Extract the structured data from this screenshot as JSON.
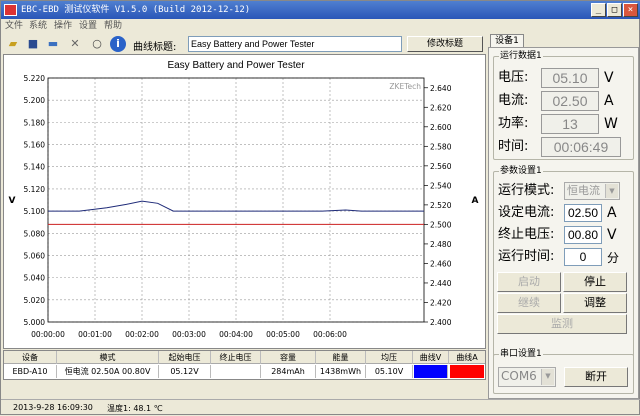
{
  "window": {
    "title": "EBC-EBD 测试仪软件 V1.5.0 (Build 2012-12-12)",
    "min": "_",
    "max": "□",
    "close": "×"
  },
  "menu": [
    "文件",
    "系统",
    "操作",
    "设置",
    "帮助"
  ],
  "toolbar": {
    "title_label": "曲线标题:",
    "title_value": "Easy Battery and Power Tester",
    "edit_title_btn": "修改标题"
  },
  "chart_data": {
    "type": "line",
    "title": "Easy Battery and Power Tester",
    "watermark": "ZKETech",
    "ylabel": "V",
    "y2label": "A",
    "ylim": [
      5.0,
      5.22
    ],
    "y2lim": [
      2.4,
      2.65
    ],
    "yticks": [
      "5.000",
      "5.020",
      "5.040",
      "5.060",
      "5.080",
      "5.100",
      "5.120",
      "5.140",
      "5.160",
      "5.180",
      "5.200",
      "5.220"
    ],
    "y2ticks": [
      "2.400",
      "2.420",
      "2.440",
      "2.460",
      "2.480",
      "2.500",
      "2.520",
      "2.540",
      "2.560",
      "2.580",
      "2.600",
      "2.620",
      "2.640"
    ],
    "xticks": [
      "00:00:00",
      "00:01:00",
      "00:02:00",
      "00:03:00",
      "00:04:00",
      "00:05:00",
      "00:06:00"
    ],
    "xlim": [
      0,
      480
    ],
    "grid": true,
    "series": [
      {
        "axis": "left",
        "color": "#1e2a78",
        "x": [
          0,
          5,
          12,
          40,
          75,
          100,
          120,
          140,
          160,
          175,
          180,
          280,
          300,
          350,
          380,
          400,
          480
        ],
        "y": [
          5.1,
          5.1,
          5.1,
          5.1,
          5.103,
          5.106,
          5.109,
          5.107,
          5.1,
          5.1,
          5.1,
          5.1,
          5.1,
          5.1,
          5.101,
          5.1,
          5.1
        ]
      },
      {
        "axis": "right",
        "color": "#cc2020",
        "x": [
          0,
          480
        ],
        "y": [
          2.5,
          2.5
        ]
      }
    ]
  },
  "table": {
    "headers": [
      "设备",
      "模式",
      "起始电压",
      "终止电压",
      "容量",
      "能量",
      "均压",
      "曲线V",
      "曲线A"
    ],
    "rows": [
      [
        "EBD-A10",
        "恒电流  02.50A  00.80V",
        "05.12V",
        "",
        "284mAh",
        "1438mWh",
        "05.10V",
        "",
        ""
      ]
    ],
    "curve_colors": [
      "#0000ff",
      "#ff0000"
    ]
  },
  "status": {
    "datetime": "2013-9-28 16:09:30",
    "temp": "温度1: 48.1 ℃"
  },
  "side": {
    "tab": "设备1",
    "run_data": {
      "title": "运行数据1",
      "rows": [
        {
          "label": "电压:",
          "value": "05.10",
          "unit": "V"
        },
        {
          "label": "电流:",
          "value": "02.50",
          "unit": "A"
        },
        {
          "label": "功率:",
          "value": "13",
          "unit": "W"
        },
        {
          "label": "时间:",
          "value": "00:06:49",
          "unit": ""
        }
      ]
    },
    "params": {
      "title": "参数设置1",
      "mode_label": "运行模式:",
      "mode_value": "恒电流",
      "current_label": "设定电流:",
      "current_value": "02.50",
      "current_unit": "A",
      "endv_label": "终止电压:",
      "endv_value": "00.80",
      "endv_unit": "V",
      "time_label": "运行时间:",
      "time_value": "0",
      "time_unit": "分",
      "start_btn": "启动",
      "stop_btn": "停止",
      "continue_btn": "继续",
      "adjust_btn": "调整",
      "monitor_btn": "监测"
    },
    "serial": {
      "title": "串口设置1",
      "port": "COM6",
      "disconnect_btn": "断开"
    }
  }
}
